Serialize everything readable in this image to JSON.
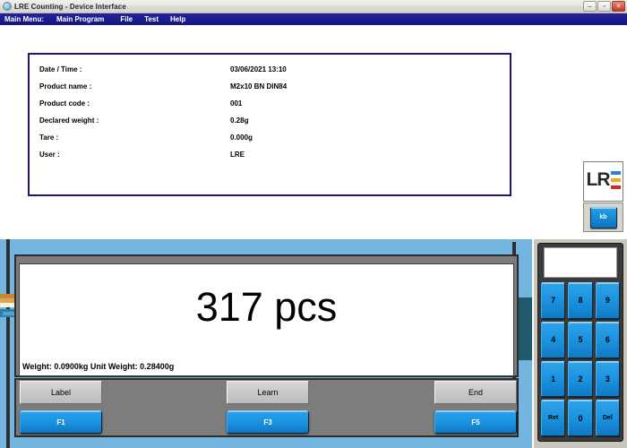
{
  "window": {
    "title": "LRE Counting - Device Interface",
    "icon": "app-icon",
    "minimize": "–",
    "maximize": "▫",
    "close": "✕"
  },
  "menubar": {
    "label": "Main Menu:",
    "items": [
      {
        "label": "Main Program"
      },
      {
        "label": "File"
      },
      {
        "label": "Test"
      },
      {
        "label": "Help"
      }
    ]
  },
  "info_panel": {
    "rows": [
      {
        "label": "Date / Time :",
        "value": "03/06/2021 13:10"
      },
      {
        "label": "Product name :",
        "value": "M2x10 BN DIN84"
      },
      {
        "label": "Product code :",
        "value": "001"
      },
      {
        "label": "Declared weight :",
        "value": "0.28g"
      },
      {
        "label": "Tare :",
        "value": "0.000g"
      },
      {
        "label": "User :",
        "value": "LRE"
      }
    ],
    "border_color": "#181880"
  },
  "logo": {
    "text": "LR",
    "bars": [
      {
        "color": "#2b7fd4"
      },
      {
        "color": "#f0a81e"
      },
      {
        "color": "#e0241c"
      }
    ],
    "kb_button": "kb"
  },
  "device": {
    "screen": {
      "count": "317 pcs",
      "weight_line": "Weight:  0.0900kg  Unit Weight: 0.28400g"
    },
    "buttons": [
      {
        "label": "Label",
        "fkey": "F1"
      },
      {
        "label": "Learn",
        "fkey": "F3"
      },
      {
        "label": "End",
        "fkey": "F5"
      }
    ],
    "body_color": "#74b5e0",
    "accent_color": "#1b93e0"
  },
  "keypad": {
    "display_value": "",
    "keys": [
      {
        "label": "7"
      },
      {
        "label": "8"
      },
      {
        "label": "9"
      },
      {
        "label": "4"
      },
      {
        "label": "5"
      },
      {
        "label": "6"
      },
      {
        "label": "1"
      },
      {
        "label": "2"
      },
      {
        "label": "3"
      },
      {
        "label": "Ret"
      },
      {
        "label": "0"
      },
      {
        "label": "Del"
      }
    ]
  }
}
